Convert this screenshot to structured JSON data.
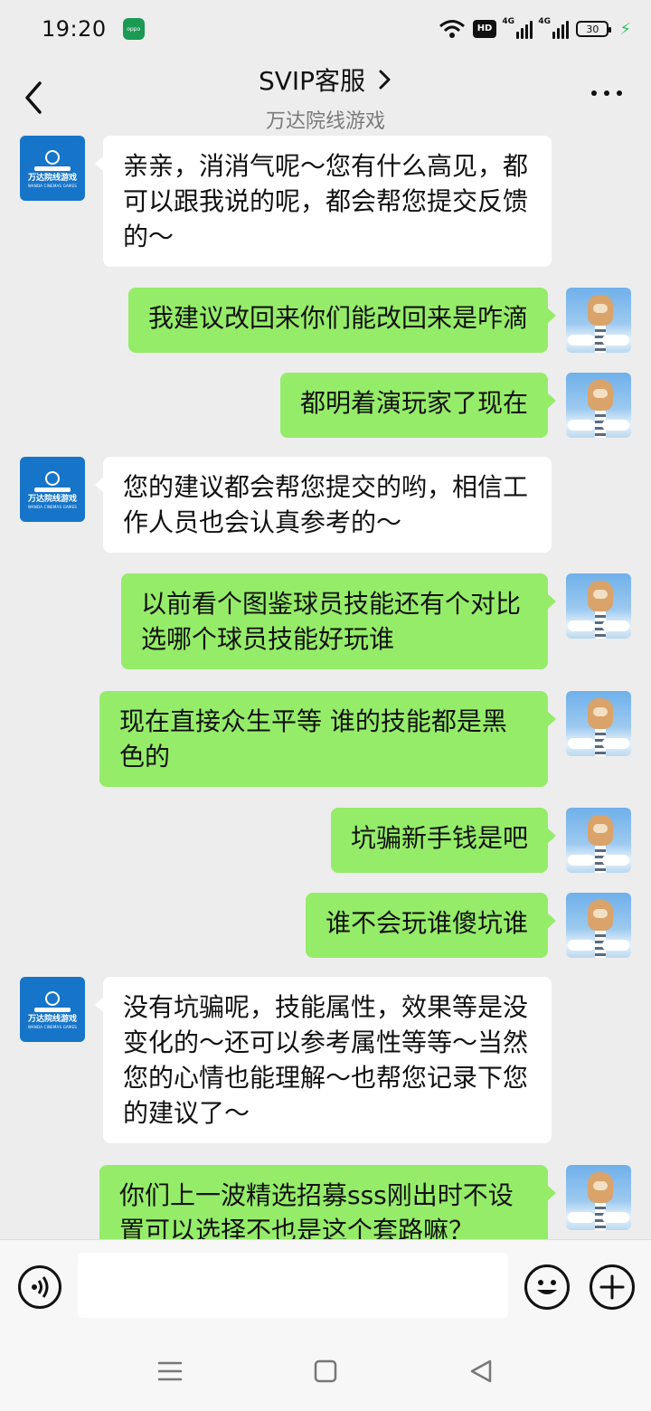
{
  "status_bar": {
    "time": "19:20",
    "app_badge": "oppo",
    "network_hd": "HD",
    "network_1": "4G",
    "network_2": "4G",
    "battery": "30"
  },
  "header": {
    "title": "SVIP客服",
    "subtitle": "万达院线游戏"
  },
  "brand_avatar": {
    "name_cn": "万达院线游戏",
    "name_en": "WANDA CINEMAS GAMES"
  },
  "messages": [
    {
      "side": "left",
      "text": "亲亲，消消气呢～您有什么高见，都可以跟我说的呢，都会帮您提交反馈的～"
    },
    {
      "side": "right",
      "text": "我建议改回来你们能改回来是咋滴"
    },
    {
      "side": "right",
      "text": "都明着演玩家了现在"
    },
    {
      "side": "left",
      "text": "您的建议都会帮您提交的哟，相信工作人员也会认真参考的～"
    },
    {
      "side": "right",
      "text": "以前看个图鉴球员技能还有个对比  选哪个球员技能好玩谁"
    },
    {
      "side": "right",
      "text": "现在直接众生平等  谁的技能都是黑色的"
    },
    {
      "side": "right",
      "text": "坑骗新手钱是吧"
    },
    {
      "side": "right",
      "text": "谁不会玩谁傻坑谁"
    },
    {
      "side": "left",
      "text": "没有坑骗呢，技能属性，效果等是没变化的～还可以参考属性等等～当然您的心情也能理解～也帮您记录下您的建议了～"
    },
    {
      "side": "right",
      "text": "你们上一波精选招募sss刚出时不设置可以选择不也是这个套路嘛？"
    }
  ],
  "input": {
    "value": ""
  },
  "colors": {
    "background": "#ededed",
    "outgoing_bubble": "#95ec69",
    "incoming_bubble": "#ffffff",
    "brand_blue": "#1675c9"
  }
}
